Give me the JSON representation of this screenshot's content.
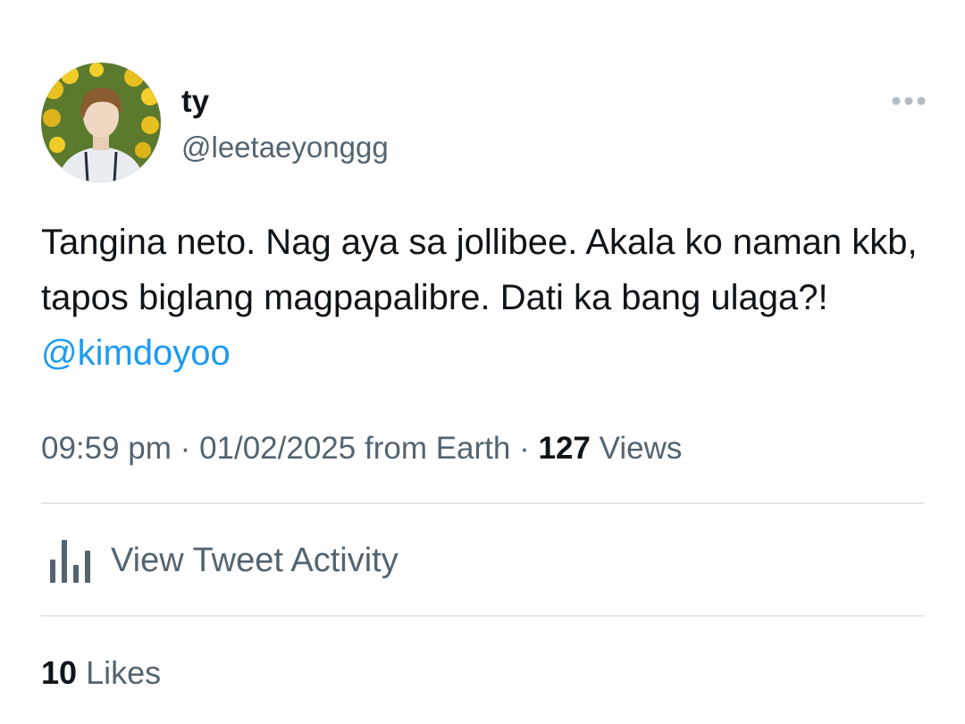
{
  "author": {
    "display_name": "ty",
    "handle": "@leetaeyonggg"
  },
  "tweet": {
    "text": "Tangina neto. Nag aya sa jollibee. Akala ko naman kkb, tapos biglang magpapalibre. Dati ka bang ulaga?! ",
    "mention": "@kimdoyoo"
  },
  "meta": {
    "time": "09:59 pm",
    "separator": "·",
    "date": "01/02/2025",
    "source": "from Earth",
    "views_count": "127",
    "views_label": "Views"
  },
  "activity": {
    "label": "View Tweet Activity",
    "icon": "bar-chart-icon"
  },
  "likes": {
    "count": "10",
    "label": "Likes"
  },
  "icons": {
    "more": "more-horizontal-icon"
  },
  "colors": {
    "link": "#1d9bf0",
    "secondary_text": "#536471",
    "primary_text": "#0f1419",
    "divider": "#e1e6ea"
  }
}
